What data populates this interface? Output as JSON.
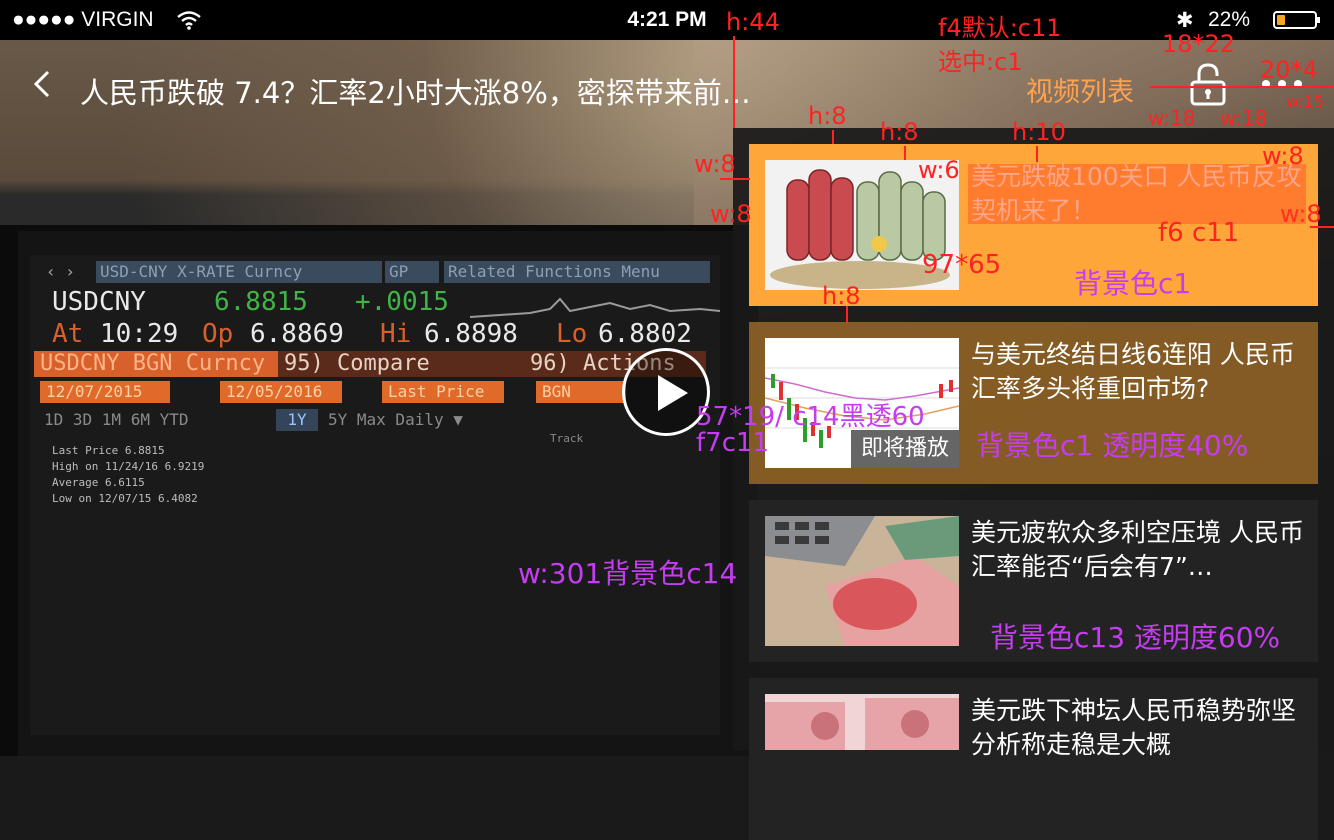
{
  "status_bar": {
    "carrier": "●●●●● VIRGIN",
    "time": "4:21 PM",
    "bluetooth": "✱",
    "battery_percent": "22%",
    "battery_level": 0.22
  },
  "nav": {
    "back_icon": "chevron-left-icon",
    "title": "人民币跌破 7.4？汇率2小时大涨8%，密探带来前…",
    "video_list_label": "视频列表",
    "lock_icon": "lock-icon",
    "more_icon": "more-horizontal-icon"
  },
  "terminal": {
    "menu_security": "USD-CNY X-RATE Curncy",
    "menu_gp": "GP",
    "menu_related": "Related Functions  Menu",
    "ticker": "USDCNY",
    "price": "6.8815",
    "change": "+.0015",
    "at_label": "At",
    "at_time": "10:29",
    "op_label": "Op",
    "op_value": "6.8869",
    "hi_label": "Hi",
    "hi_value": "6.8898",
    "lo_label": "Lo",
    "lo_value": "6.8802",
    "curncy": "USDCNY BGN Curncy",
    "compare": "95) Compare",
    "actions": "96) Actions",
    "date_from": "12/07/2015",
    "date_to": "12/05/2016",
    "last_price": "Last Price",
    "bgn": "BGN",
    "periods": "1D  3D  1M  6M  YTD",
    "period_selected": "1Y",
    "periods_after": "5Y  Max  Daily ▼",
    "track": "Track",
    "legend_last": "Last Price      6.8815",
    "legend_high": "High on 11/24/16  6.9219",
    "legend_avg": "Average          6.6115",
    "legend_low": "Low on 12/07/15   6.4082"
  },
  "player": {
    "play_icon": "play-icon"
  },
  "video_list": [
    {
      "title": "美元跌破100关口  人民币反攻契机来了！",
      "thumb": "money-rolls-image",
      "state": "selected"
    },
    {
      "title": "与美元终结日线6连阳 人民币汇率多头将重回市场?",
      "thumb": "candlestick-chart-image",
      "badge": "即将播放"
    },
    {
      "title": "美元疲软众多利空压境 人民币汇率能否“后会有7”…",
      "thumb": "calculator-money-image"
    },
    {
      "title": "美元跌下神坛人民币稳势弥坚 分析称走稳是大概",
      "thumb": "rmb-notes-image"
    }
  ],
  "annotations": {
    "h44": "h:44",
    "f4_default": "f4默认:c11",
    "selected_c1": "选中:c1",
    "size_18_22": "18*22",
    "size_20_4": "20*4",
    "w15": "w:15",
    "w18a": "w:18",
    "w18b": "w:18",
    "h8_top": "h:8",
    "h8_b": "h:8",
    "h10": "h:10",
    "w8_a": "w:8",
    "w6": "w:6",
    "w8_r": "w:8",
    "w8_b": "w:8",
    "w8_c": "w:8",
    "f6_c11": "f6 c11",
    "size_97_65": "97*65",
    "bg_c1": "背景色c1",
    "h8_mid": "h:8",
    "badge_spec": "57*19/ c14黑透60",
    "f7c11": "f7c11",
    "bg_c1_alpha": "背景色c1   透明度40%",
    "w301": "w:301背景色c14",
    "bg_c13_alpha": "背景色c13   透明度60%"
  },
  "colors": {
    "accent": "#ffa63a",
    "annotation_red": "#ff2222",
    "annotation_purple": "#c63cf0"
  }
}
